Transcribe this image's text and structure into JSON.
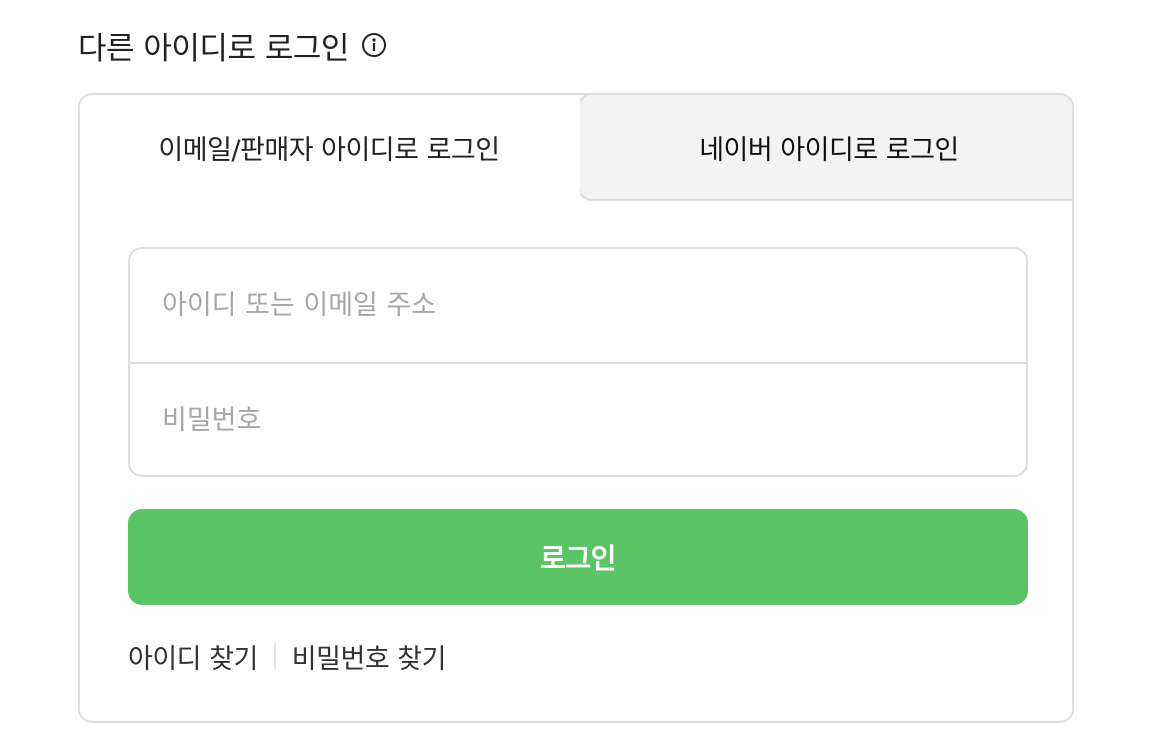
{
  "header": {
    "title": "다른 아이디로 로그인",
    "info_icon": "info-circle-icon"
  },
  "tabs": [
    {
      "label": "이메일/판매자 아이디로 로그인",
      "active": true
    },
    {
      "label": "네이버 아이디로 로그인",
      "active": false
    }
  ],
  "form": {
    "id_placeholder": "아이디 또는 이메일 주소",
    "id_value": "",
    "password_placeholder": "비밀번호",
    "password_value": ""
  },
  "login_button": {
    "label": "로그인",
    "color": "#5ac466"
  },
  "links": {
    "find_id": "아이디 찾기",
    "find_password": "비밀번호 찾기"
  }
}
